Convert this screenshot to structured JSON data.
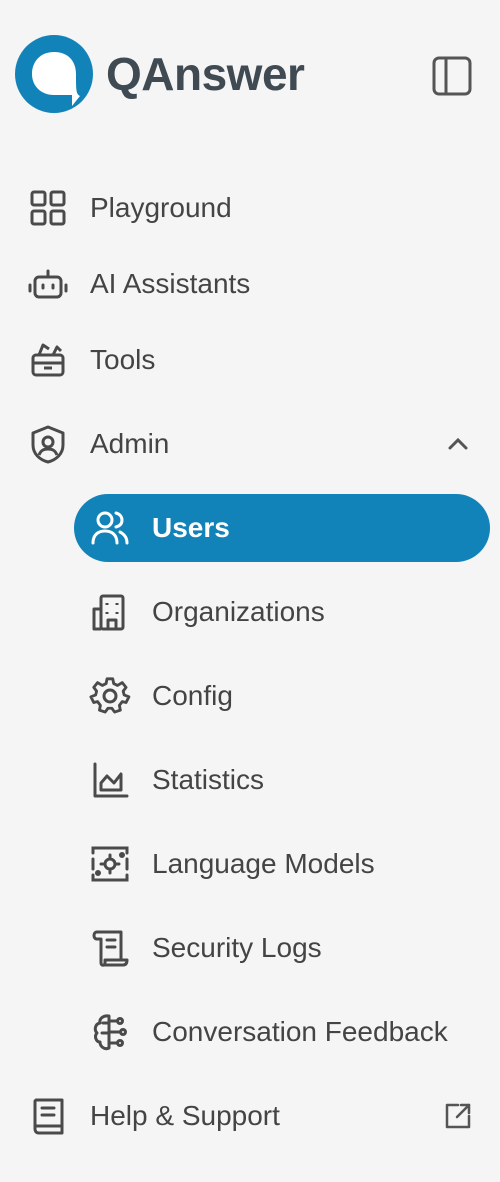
{
  "brand": {
    "name": "QAnswer",
    "accent_color": "#1283b8"
  },
  "header": {
    "toggle_icon": "sidebar-panel-icon"
  },
  "nav": {
    "playground": {
      "label": "Playground",
      "icon": "grid-icon"
    },
    "ai_assistants": {
      "label": "AI Assistants",
      "icon": "robot-icon"
    },
    "tools": {
      "label": "Tools",
      "icon": "toolbox-icon"
    },
    "admin": {
      "label": "Admin",
      "icon": "shield-user-icon",
      "expanded": true,
      "children": [
        {
          "label": "Users",
          "icon": "users-icon",
          "active": true
        },
        {
          "label": "Organizations",
          "icon": "building-icon"
        },
        {
          "label": "Config",
          "icon": "gear-icon"
        },
        {
          "label": "Statistics",
          "icon": "chart-icon"
        },
        {
          "label": "Language Models",
          "icon": "model-chip-icon"
        },
        {
          "label": "Security Logs",
          "icon": "scroll-icon"
        },
        {
          "label": "Conversation Feedback",
          "icon": "brain-icon"
        }
      ]
    },
    "help": {
      "label": "Help & Support",
      "icon": "book-icon",
      "external": true
    }
  }
}
